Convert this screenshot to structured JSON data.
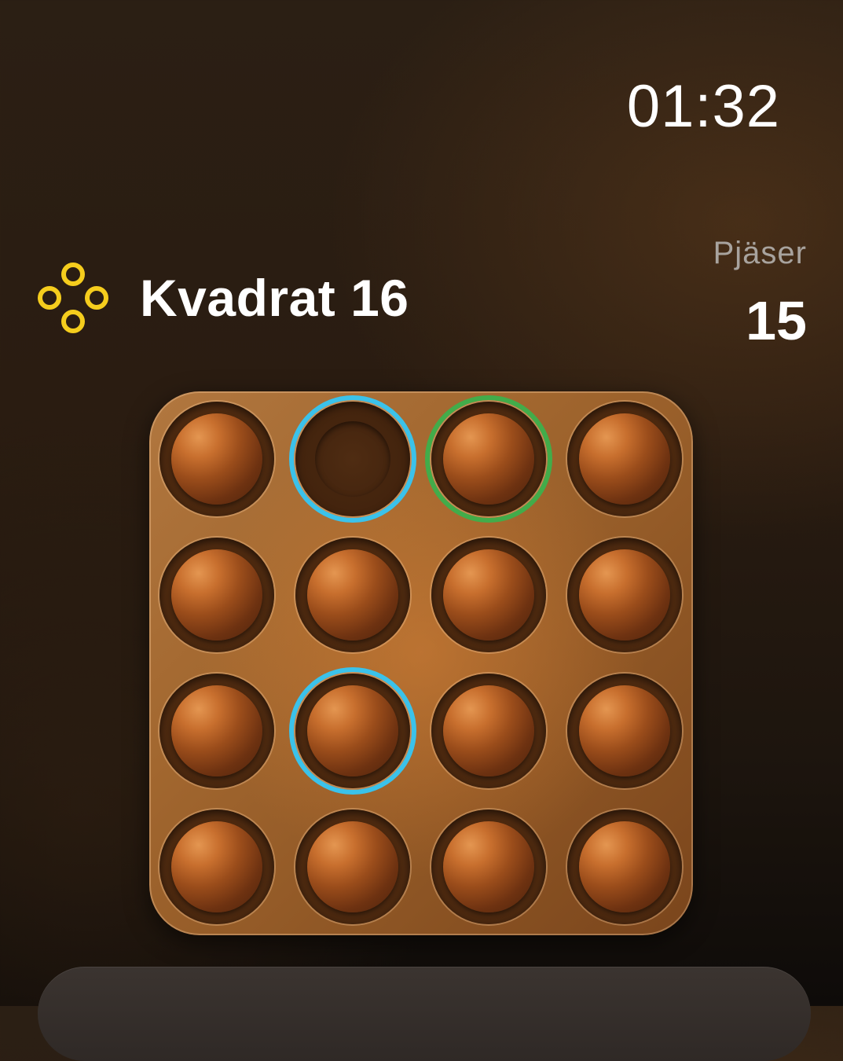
{
  "status": {
    "time": "01:32"
  },
  "header": {
    "title": "Kvadrat 16",
    "icon": "four-circles-icon",
    "icon_color": "#f5cd1d"
  },
  "pieces": {
    "label": "Pjäser",
    "count": "15"
  },
  "board": {
    "rows": 4,
    "cols": 4,
    "highlight_colors": {
      "blue": "#3bc2ea",
      "green": "#42ac4a"
    },
    "cells": [
      {
        "peg": true,
        "ring": null
      },
      {
        "peg": false,
        "ring": "blue"
      },
      {
        "peg": true,
        "ring": "green"
      },
      {
        "peg": true,
        "ring": null
      },
      {
        "peg": true,
        "ring": null
      },
      {
        "peg": true,
        "ring": null
      },
      {
        "peg": true,
        "ring": null
      },
      {
        "peg": true,
        "ring": null
      },
      {
        "peg": true,
        "ring": null
      },
      {
        "peg": true,
        "ring": "blue"
      },
      {
        "peg": true,
        "ring": null
      },
      {
        "peg": true,
        "ring": null
      },
      {
        "peg": true,
        "ring": null
      },
      {
        "peg": true,
        "ring": null
      },
      {
        "peg": true,
        "ring": null
      },
      {
        "peg": true,
        "ring": null
      }
    ]
  }
}
